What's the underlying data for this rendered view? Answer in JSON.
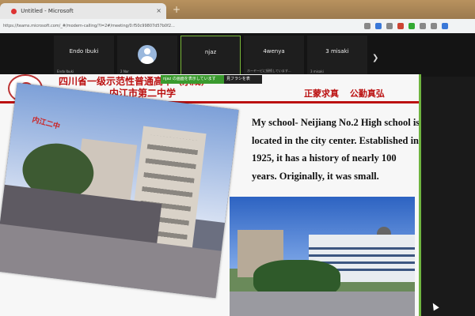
{
  "browser": {
    "tab_title": "Untitled - Microsoft",
    "tab_close": "×",
    "new_tab": "+",
    "url": "https://teams.microsoft.com/_#/modern-calling/?l=2#/meeting/0:f50c99807d57b0f2..."
  },
  "participants": [
    {
      "name": "Endo Ibuki",
      "sub": "Endo Ibuki",
      "active": false
    },
    {
      "name": "",
      "sub": "2 Nor",
      "active": false
    },
    {
      "name": "njaz",
      "sub": "",
      "active": true
    },
    {
      "name": "4wenya",
      "sub": "ホーヤービに接続しています...",
      "active": false
    },
    {
      "name": "3 misaki",
      "sub": "3 misaki",
      "active": false
    }
  ],
  "next_icon": "chevron-right-icon",
  "slide": {
    "title_line1": "四川省一级示范性普通高中（乐成）",
    "title_line2": "内江市第二中学",
    "motto": "正蒙求真 公勤真弘",
    "banner_text": "内江二中",
    "tooltip_green": "njaz の画面を表示しています",
    "tooltip_dark": "見フラシを表",
    "paragraph": "My school- Neijiang No.2 High school is located in the city center. Established in 1925, it has a history of nearly 100 years. Originally, it was small."
  },
  "colors": {
    "accent_red": "#b11111",
    "active_border": "#7ab83a",
    "green_tip": "#3a9a2e"
  }
}
